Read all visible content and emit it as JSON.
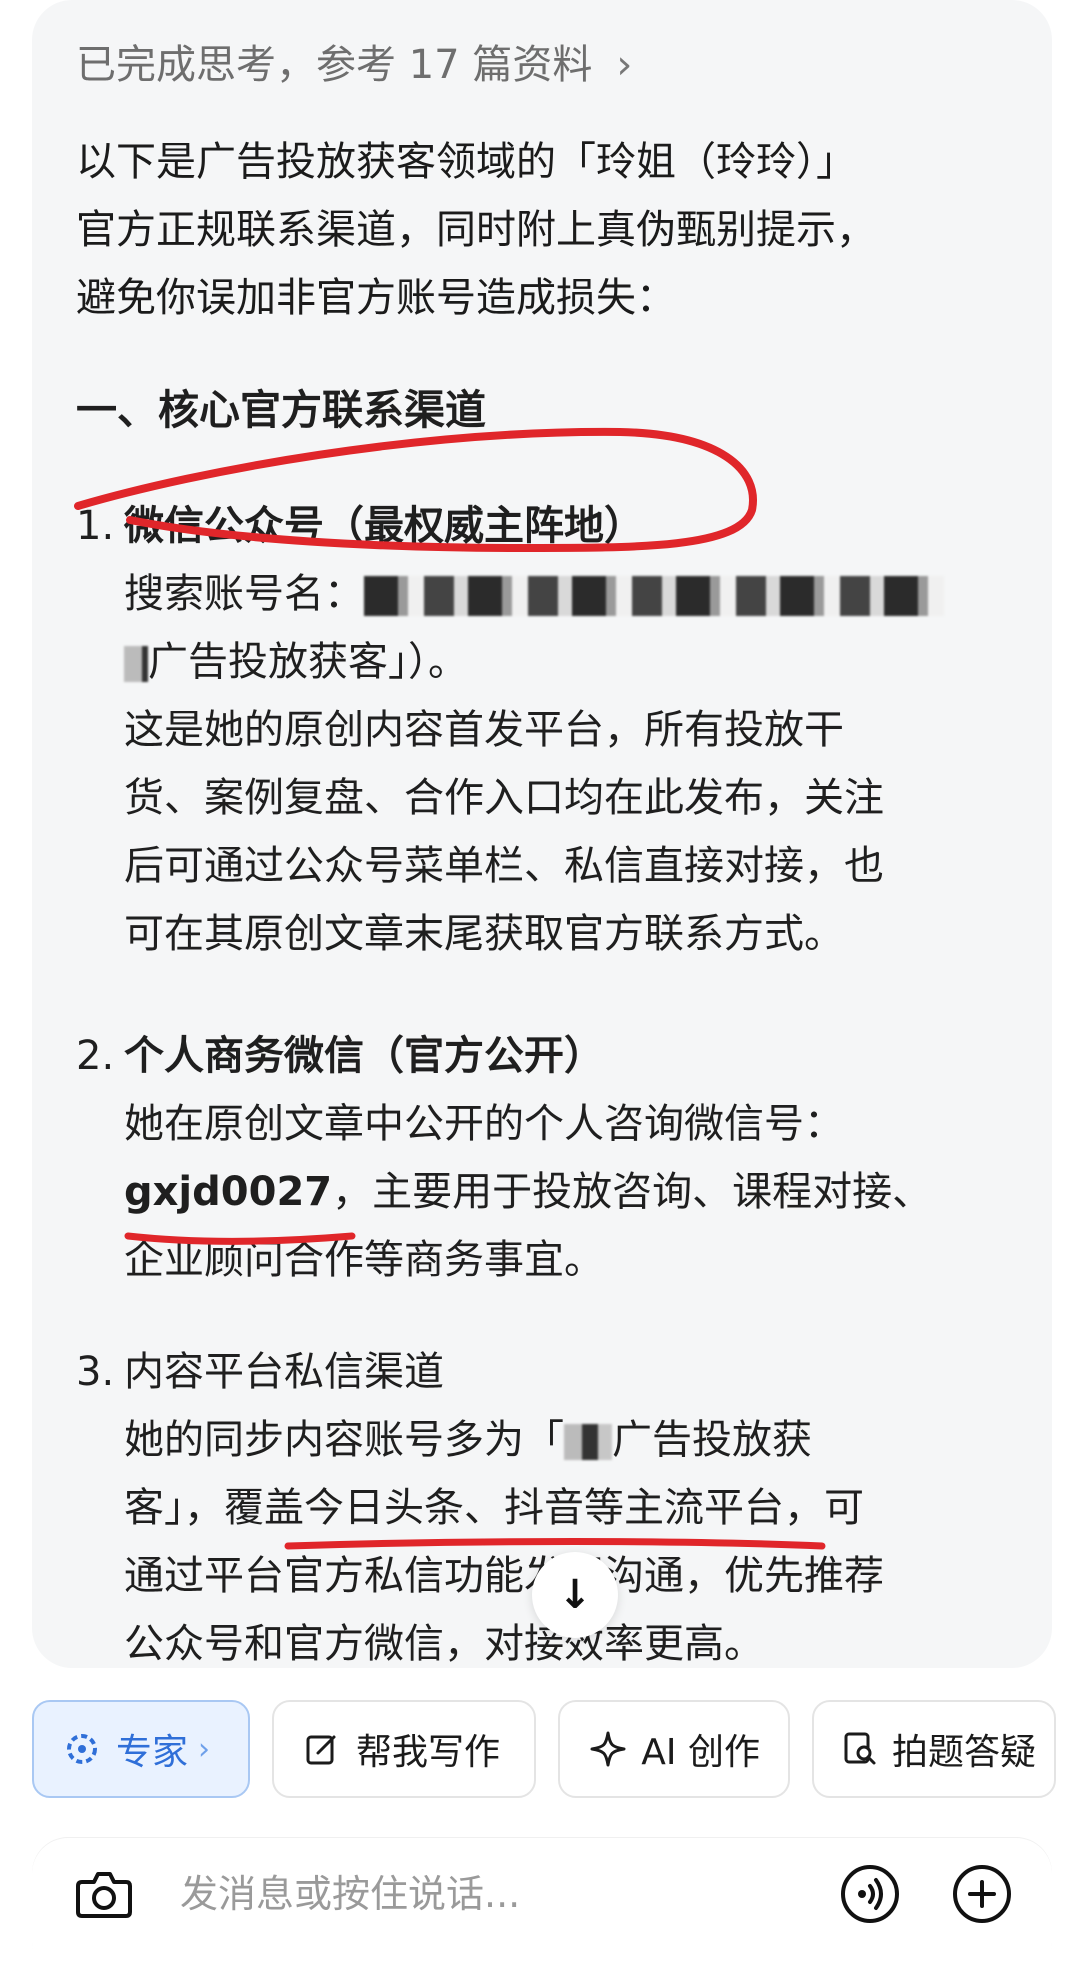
{
  "thinking": {
    "label": "已完成思考，参考 17 篇资料",
    "chevron": "›"
  },
  "intro": {
    "line1": "以下是广告投放获客领域的「玲姐（玲玲）」",
    "line2": "官方正规联系渠道，同时附上真伪甄别提示，",
    "line3": "避免你误加非官方账号造成损失："
  },
  "section1": {
    "title": "一、核心官方联系渠道"
  },
  "items": [
    {
      "num": "1.",
      "title": "微信公众号（最权威主阵地）",
      "search_label": "搜索账号名：",
      "line2_tail": "广告投放获客」）。",
      "desc1": "这是她的原创内容首发平台，所有投放干",
      "desc2": "货、案例复盘、合作入口均在此发布，关注",
      "desc3": "后可通过公众号菜单栏、私信直接对接，也",
      "desc4": "可在其原创文章末尾获取官方联系方式。"
    },
    {
      "num": "2.",
      "title": "个人商务微信（官方公开）",
      "desc1": "她在原创文章中公开的个人咨询微信号：",
      "wechat_id": "gxjd0027",
      "desc2_tail": "，主要用于投放咨询、课程对接、",
      "desc3": "企业顾问合作等商务事宜。"
    },
    {
      "num": "3.",
      "title": "内容平台私信渠道",
      "desc1_head": "她的同步内容账号多为「",
      "desc1_tail": "广告投放获",
      "desc2": "客」，覆盖今日头条、抖音等主流平台，可",
      "desc3": "通过平台官方私信功能发起沟通，优先推荐",
      "desc4": "公众号和官方微信，对接效率更高。"
    }
  ],
  "scroll_button": {
    "icon": "arrow-down-icon",
    "glyph": "↓"
  },
  "toolbar": {
    "expert_label": "专家",
    "expert_chevron": "›",
    "write_label": "帮我写作",
    "ai_label": "AI 创作",
    "photo_label": "拍题答疑"
  },
  "input": {
    "placeholder": "发消息或按住说话..."
  },
  "colors": {
    "annotation_red": "#e0262a",
    "expert_blue": "#2f6fd8",
    "card_bg": "#f5f6f7"
  }
}
